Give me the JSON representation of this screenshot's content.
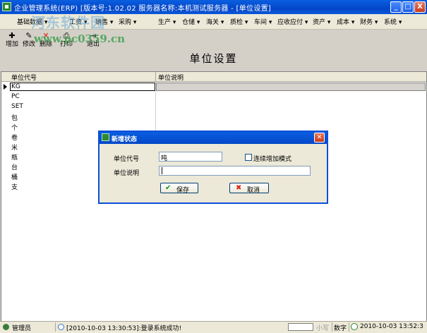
{
  "window": {
    "title": "企业管理系统(ERP)  [版本号:1.02.02  服务器名称:本机测试服务器 - [单位设置]",
    "buttons": {
      "minimize": "_",
      "maximize": "□",
      "close": "X"
    }
  },
  "menu": {
    "items": [
      "基础数据",
      "工资",
      "销售",
      "采购",
      "生产",
      "仓储",
      "海关",
      "质检",
      "车间",
      "应收应付",
      "资产",
      "成本",
      "财务",
      "系统"
    ]
  },
  "toolbar": {
    "buttons": [
      {
        "label": "增加",
        "icon": "add-icon"
      },
      {
        "label": "修改",
        "icon": "edit-icon"
      },
      {
        "label": "删除",
        "icon": "delete-icon"
      },
      {
        "label": "打印",
        "icon": "printer-icon"
      },
      {
        "label": "退出",
        "icon": "exit-icon"
      }
    ]
  },
  "watermark": {
    "text": "www.pc0359.cn",
    "logo_text": "河东软件园"
  },
  "form": {
    "title": "单位设置"
  },
  "grid": {
    "columns": [
      "单位代号",
      "单位说明"
    ],
    "rows": [
      "KG",
      "PC",
      "SET",
      "包",
      "个",
      "卷",
      "米",
      "瓶",
      "台",
      "桶",
      "支"
    ],
    "selected_index": 0
  },
  "dialog": {
    "title": "新增状态",
    "code_label": "单位代号",
    "code_value": "吨",
    "continuous_label": "连续增加模式",
    "desc_label": "单位说明",
    "desc_value": "",
    "save_label": "保存",
    "cancel_label": "取消"
  },
  "statusbar": {
    "user": "管理员",
    "message": "[2010-10-03 13:30:53]:登录系统成功!",
    "caps": "小写",
    "num": "数字",
    "datetime": "2010-10-03 13:52:3"
  },
  "colors": {
    "titlebar": "#0a5fe0",
    "watermark": "#3f9f4f",
    "dialog_border": "#0a4fd8"
  }
}
